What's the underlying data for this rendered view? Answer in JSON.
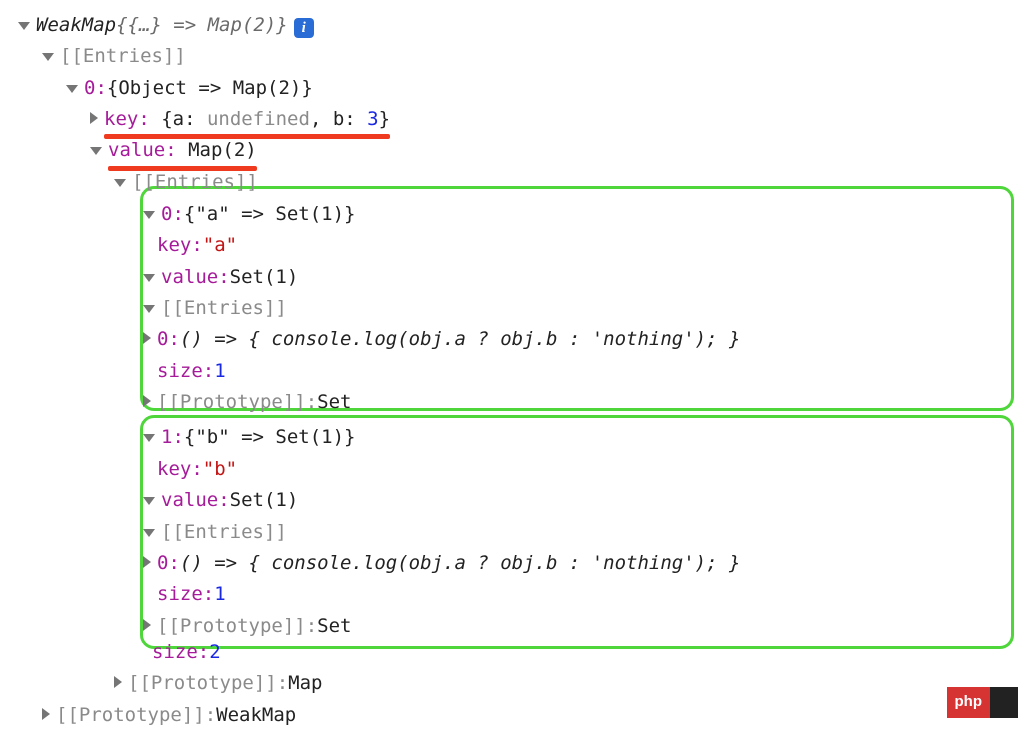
{
  "root": {
    "label_prefix": "WeakMap ",
    "label_braces": "{{…} => Map(2)}",
    "info": "i"
  },
  "entries_label": "[[Entries]]",
  "prototype_label": "[[Prototype]]",
  "entry0": {
    "idx": "0",
    "summary": "{Object => Map(2)}",
    "key_label": "key",
    "key_value_pre": "{a: ",
    "key_value_undef": "undefined",
    "key_value_mid": ", b: ",
    "key_value_num": "3",
    "key_value_post": "}",
    "value_label": "value",
    "value_summary": "Map(2)"
  },
  "mapEntries": {
    "label": "[[Entries]]",
    "e0": {
      "idx": "0",
      "summary": "{\"a\" => Set(1)}",
      "key_label": "key",
      "key_value": "\"a\"",
      "value_label": "value",
      "value_summary": "Set(1)",
      "entries_label": "[[Entries]]",
      "set0_idx": "0",
      "set0_body": "() => { console.log(obj.a ? obj.b : 'nothing'); }",
      "size_label": "size",
      "size_value": "1",
      "proto_label": "[[Prototype]]",
      "proto_value": "Set"
    },
    "e1": {
      "idx": "1",
      "summary": "{\"b\" => Set(1)}",
      "key_label": "key",
      "key_value": "\"b\"",
      "value_label": "value",
      "value_summary": "Set(1)",
      "entries_label": "[[Entries]]",
      "set0_idx": "0",
      "set0_body": "() => { console.log(obj.a ? obj.b : 'nothing'); }",
      "size_label": "size",
      "size_value": "1",
      "proto_label": "[[Prototype]]",
      "proto_value": "Set"
    },
    "size_label": "size",
    "size_value": "2",
    "proto_label": "[[Prototype]]",
    "proto_value": "Map"
  },
  "rootProto": {
    "label": "[[Prototype]]",
    "value": "WeakMap"
  },
  "badge": {
    "left": "php",
    "right": "  "
  }
}
